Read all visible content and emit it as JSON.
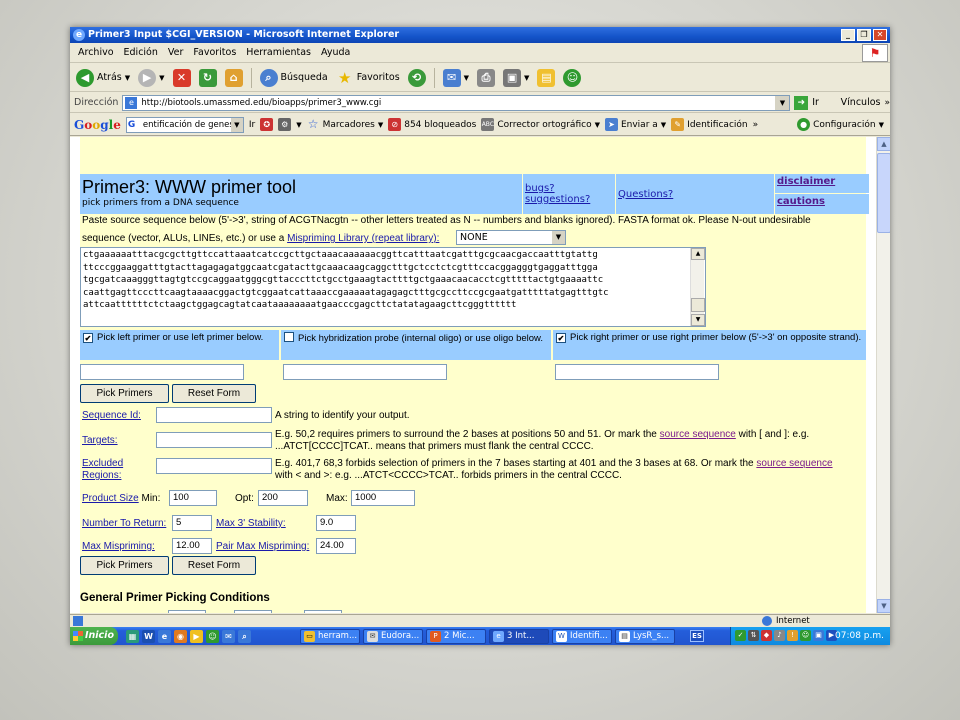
{
  "window": {
    "title": "Primer3 Input $CGI_VERSION - Microsoft Internet Explorer",
    "controls": [
      "_",
      "❐",
      "✕"
    ]
  },
  "menu": [
    "Archivo",
    "Edición",
    "Ver",
    "Favoritos",
    "Herramientas",
    "Ayuda"
  ],
  "toolbar": {
    "back": "Atrás",
    "search": "Búsqueda",
    "favorites": "Favoritos"
  },
  "address": {
    "label": "Dirección",
    "url": "http://biotools.umassmed.edu/bioapps/primer3_www.cgi",
    "go": "Ir",
    "links": "Vínculos"
  },
  "google_bar": {
    "logo": "Google",
    "search_value": "entificación de genes",
    "go": "Ir",
    "bookmarks": "Marcadores",
    "blocked": "854 bloqueados",
    "spellcheck": "Corrector ortográfico",
    "send": "Enviar a",
    "autofill": "Identificación",
    "settings": "Configuración"
  },
  "page": {
    "title": "Primer3: WWW primer tool",
    "subtitle": "pick primers from a DNA sequence",
    "links": {
      "disclaimer": "disclaimer",
      "cautions": "cautions",
      "bugs": "bugs? suggestions?",
      "questions": "Questions?"
    },
    "intro_1": "Paste source sequence below (5'->3', string of ACGTNacgtn -- other letters treated as N -- numbers and blanks ignored). FASTA format ok. Please N-out undesirable",
    "intro_2a": "sequence (vector, ALUs, LINEs, etc.) or use a",
    "intro_2_link": "Mispriming Library (repeat library):",
    "mispriming_value": "NONE",
    "sequence": "ctgaaaaaatttacgcgcttgttccattaaatcatccgcttgctaaacaaaaaacggttcatttaatcgatttgcgcaacgaccaatttgtattg\nttcccggaaggatttgtacttagagagatggcaatcgatacttgcaaacaagcaggctttgctcctctcgtttccacggagggtgaggatttgga\ntgcgatcaaagggttagtgtccgcaggaatgggcgttacccttctgcctgaaagtacttttgctgaaacaacacctcgtttttactgtgaaaattc\ncaattgagttcccttcaagtaaaacggactgtcggaatcattaaaccgaaaaatagagagctttgcgccttccgcgaatgatttttatgagtttgtc\nattcaattttttctctaagctggagcagtatcaataaaaaaaatgaacccgagcttctatatagaagcttcgggtttttt",
    "pick_left": "Pick left primer or use left primer below.",
    "pick_probe": "Pick hybridization probe (internal oligo) or use oligo below.",
    "pick_right": "Pick right primer or use right primer below (5'->3' on opposite strand).",
    "pick_left_checked": true,
    "pick_probe_checked": false,
    "pick_right_checked": true,
    "pick_primers_btn": "Pick Primers",
    "reset_btn": "Reset Form",
    "sequence_id_label": "Sequence Id:",
    "sequence_id_help": "A string to identify your output.",
    "targets_label": "Targets:",
    "targets_help_1a": "E.g. 50,2 requires primers to surround the 2 bases at positions 50 and 51. Or mark the",
    "targets_help_link": "source sequence",
    "targets_help_1b": "with [ and ]: e.g.",
    "targets_help_2": "...ATCT[CCCC]TCAT.. means that primers must flank the central CCCC.",
    "excluded_label_1": "Excluded",
    "excluded_label_2": "Regions:",
    "excluded_help_1a": "E.g. 401,7 68,3 forbids selection of primers in the 7 bases starting at 401 and the 3 bases at 68. Or mark the",
    "excluded_help_link": "source sequence",
    "excluded_help_2": "with < and >: e.g. ...ATCT<CCCC>TCAT.. forbids primers in the central CCCC.",
    "product_size_label": "Product Size",
    "min_label": "Min:",
    "min_value": "100",
    "opt_label": "Opt:",
    "opt_value": "200",
    "max_label": "Max:",
    "max_value": "1000",
    "num_return_label": "Number To Return:",
    "num_return_value": "5",
    "max3_label": "Max 3' Stability:",
    "max3_value": "9.0",
    "max_mispriming_label": "Max Mispriming:",
    "max_mispriming_value": "12.00",
    "pair_max_label": "Pair Max Mispriming:",
    "pair_max_value": "24.00",
    "section_general": "General Primer Picking Conditions"
  },
  "status": {
    "zone": "Internet"
  },
  "taskbar": {
    "start": "Inicio",
    "tasks": [
      "herram...",
      "Eudora...",
      "2 Mic...",
      "3 Int...",
      "Identifi...",
      "LysR_s..."
    ],
    "language": "ES",
    "clock": "07:08 p.m."
  },
  "colors": {
    "page_bg": "#ffffcc",
    "header_blue": "#99ccff",
    "xp_title": "#1454c9"
  }
}
